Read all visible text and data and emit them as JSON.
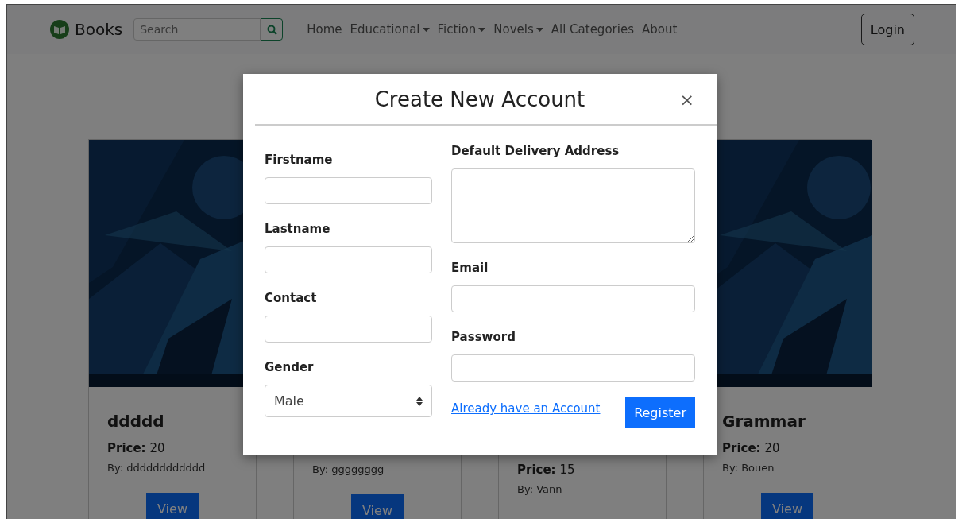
{
  "navbar": {
    "brand": "Books",
    "search": {
      "placeholder": "Search"
    },
    "links": [
      {
        "label": "Home",
        "dropdown": false
      },
      {
        "label": "Educational",
        "dropdown": true
      },
      {
        "label": "Fiction",
        "dropdown": true
      },
      {
        "label": "Novels",
        "dropdown": true
      },
      {
        "label": "All Categories",
        "dropdown": false
      },
      {
        "label": "About",
        "dropdown": false
      }
    ],
    "login": "Login"
  },
  "books": [
    {
      "cover": true,
      "title": "ddddd",
      "price_label": "Price:",
      "price": "20",
      "author": "By: dddddddddddd",
      "button": "View"
    },
    {
      "cover": false,
      "author": "By: gggggggg",
      "button": "View"
    },
    {
      "cover": false,
      "price_label": "Price:",
      "price": "15",
      "author": "By: Vann"
    },
    {
      "cover": true,
      "title": "Grammar",
      "price_label": "Price:",
      "price": "20",
      "author": "By: Bouen",
      "button": "View"
    }
  ],
  "modal": {
    "title": "Create New Account",
    "close": "×",
    "left_fields": [
      {
        "label": "Firstname",
        "kind": "text"
      },
      {
        "label": "Lastname",
        "kind": "text"
      },
      {
        "label": "Contact",
        "kind": "text"
      },
      {
        "label": "Gender",
        "kind": "select",
        "value": "Male"
      }
    ],
    "right_fields": [
      {
        "label": "Default Delivery Address",
        "kind": "textarea"
      },
      {
        "label": "Email",
        "kind": "text"
      },
      {
        "label": "Password",
        "kind": "password"
      }
    ],
    "login_link": "Already have an Account",
    "register_button": "Register"
  }
}
